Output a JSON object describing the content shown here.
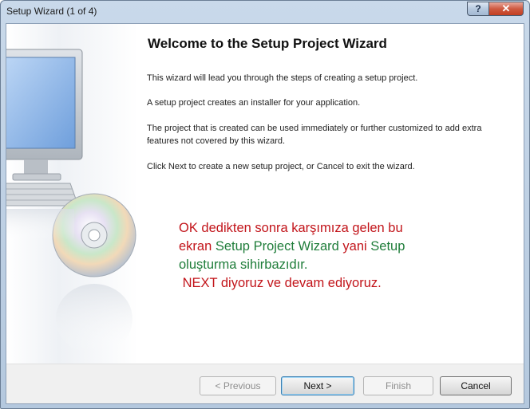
{
  "window": {
    "title": "Setup Wizard (1 of 4)",
    "help_glyph": "?",
    "close_glyph": "✕"
  },
  "page": {
    "heading": "Welcome to the Setup Project Wizard",
    "paragraphs": [
      "This wizard will lead you through the steps of creating a setup project.",
      "A setup project creates an installer for your application.",
      "The project that is created can be used immediately or further customized to add extra features not covered by this wizard.",
      "Click Next to create a new setup project, or Cancel to exit the wizard."
    ]
  },
  "annotation": {
    "line1": "OK dedikten sonra karşımıza gelen bu",
    "line2_a": "ekran ",
    "line2_b": "Setup Project Wizard",
    "line2_c": " yani ",
    "line2_d": "Setup",
    "line3": "oluşturma sihirbazıdır.",
    "line4": " NEXT diyoruz ve devam ediyoruz."
  },
  "buttons": {
    "previous": "< Previous",
    "next": "Next >",
    "finish": "Finish",
    "cancel": "Cancel"
  },
  "colors": {
    "annotation_red": "#c2141a",
    "annotation_green": "#1f7d3a",
    "titlebar": "#c9d9ea",
    "close_button": "#c94a2f"
  },
  "icons": {
    "side_art": "monitor-and-cd-icon"
  }
}
